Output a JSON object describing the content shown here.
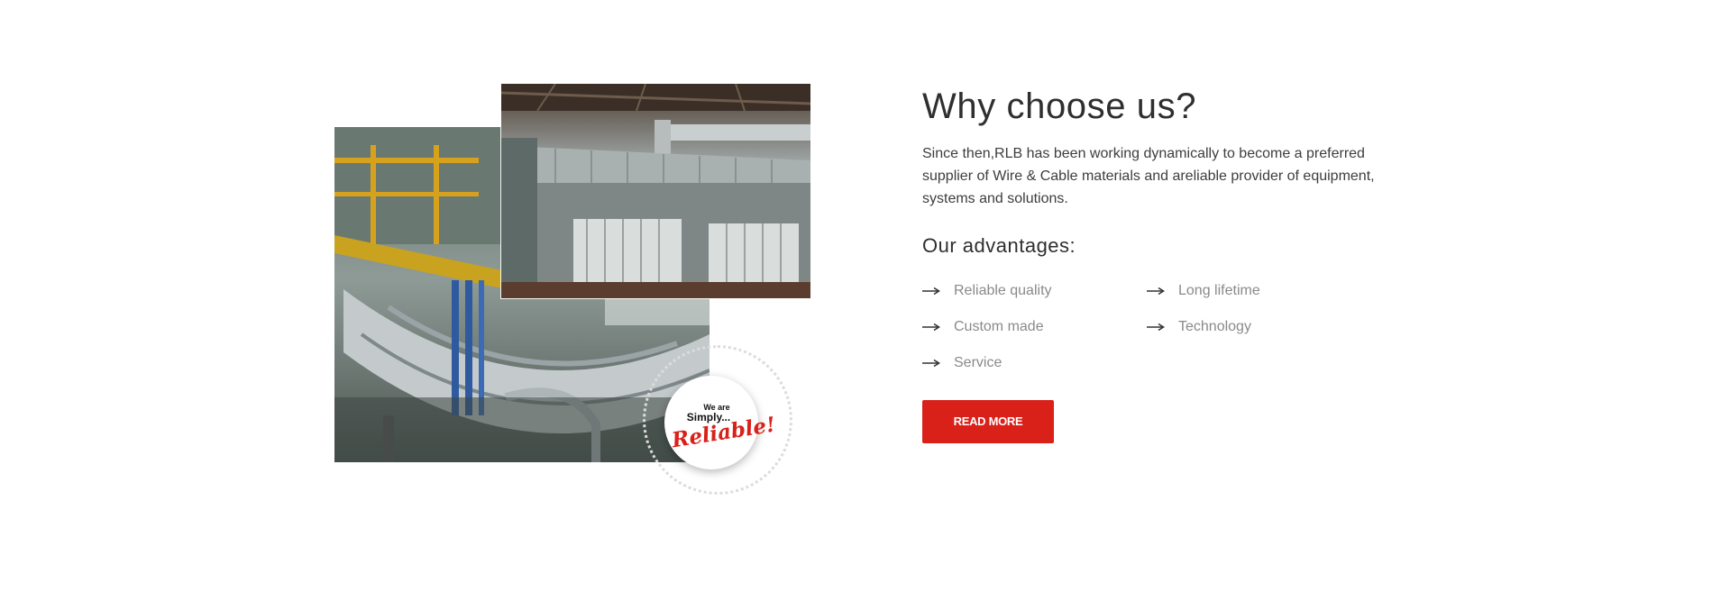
{
  "section": {
    "title": "Why choose us?",
    "intro": "Since then,RLB has been working dynamically to become a preferred supplier of Wire & Cable materials and areliable provider of equipment, systems and solutions.",
    "advantages_title": "Our advantages:",
    "advantages": [
      "Reliable quality",
      "Long lifetime",
      "Custom made",
      "Technology",
      "Service"
    ],
    "read_more_label": "READ MORE"
  },
  "badge": {
    "line1": "We are",
    "line2": "Simply...",
    "line3": "Reliable!"
  },
  "images": {
    "back": "industrial-machinery-photo",
    "front": "industrial-furnace-photo"
  },
  "icons": {
    "advantage_bullet": "long-arrow-right-icon"
  },
  "colors": {
    "accent": "#d9211a",
    "heading": "#2f2f2f",
    "body_text": "#3d3d3d",
    "list_text": "#8a8a8a"
  }
}
